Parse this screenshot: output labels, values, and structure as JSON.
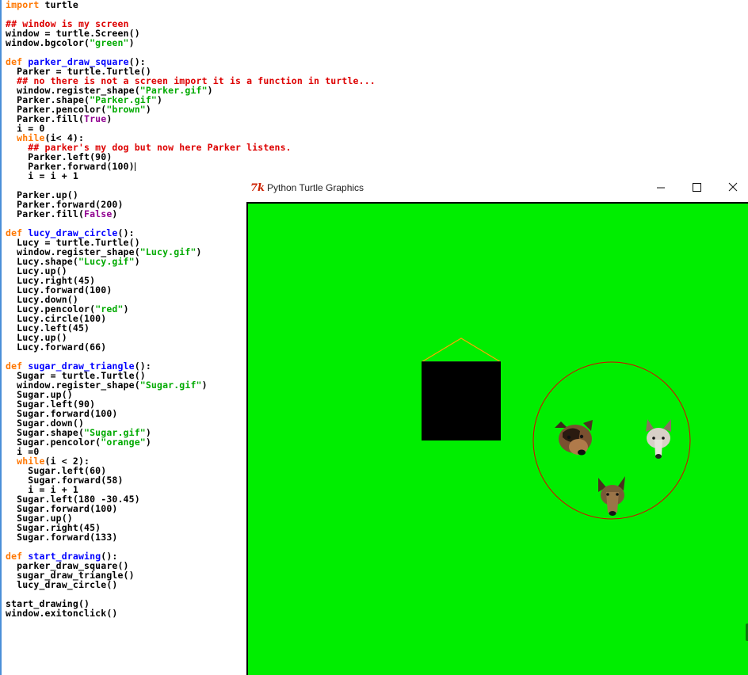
{
  "editor": {
    "lines": [
      {
        "parts": [
          {
            "t": "import",
            "c": "kw"
          },
          {
            "t": " turtle",
            "c": ""
          }
        ]
      },
      {
        "parts": []
      },
      {
        "parts": [
          {
            "t": "## window is my screen",
            "c": "cmt"
          }
        ]
      },
      {
        "parts": [
          {
            "t": "window = turtle.Screen()",
            "c": ""
          }
        ]
      },
      {
        "parts": [
          {
            "t": "window.bgcolor(",
            "c": ""
          },
          {
            "t": "\"green\"",
            "c": "str"
          },
          {
            "t": ")",
            "c": ""
          }
        ]
      },
      {
        "parts": []
      },
      {
        "parts": [
          {
            "t": "def",
            "c": "kw"
          },
          {
            "t": " ",
            "c": ""
          },
          {
            "t": "parker_draw_square",
            "c": "fn"
          },
          {
            "t": "():",
            "c": ""
          }
        ]
      },
      {
        "parts": [
          {
            "t": "  Parker = turtle.Turtle()",
            "c": ""
          }
        ]
      },
      {
        "parts": [
          {
            "t": "  ## no there is not a screen import it is a function in turtle...",
            "c": "cmt"
          }
        ]
      },
      {
        "parts": [
          {
            "t": "  window.register_shape(",
            "c": ""
          },
          {
            "t": "\"Parker.gif\"",
            "c": "str"
          },
          {
            "t": ")",
            "c": ""
          }
        ]
      },
      {
        "parts": [
          {
            "t": "  Parker.shape(",
            "c": ""
          },
          {
            "t": "\"Parker.gif\"",
            "c": "str"
          },
          {
            "t": ")",
            "c": ""
          }
        ]
      },
      {
        "parts": [
          {
            "t": "  Parker.pencolor(",
            "c": ""
          },
          {
            "t": "\"brown\"",
            "c": "str"
          },
          {
            "t": ")",
            "c": ""
          }
        ]
      },
      {
        "parts": [
          {
            "t": "  Parker.fill(",
            "c": ""
          },
          {
            "t": "True",
            "c": "bi"
          },
          {
            "t": ")",
            "c": ""
          }
        ]
      },
      {
        "parts": [
          {
            "t": "  i = 0",
            "c": ""
          }
        ]
      },
      {
        "parts": [
          {
            "t": "  ",
            "c": ""
          },
          {
            "t": "while",
            "c": "kw"
          },
          {
            "t": "(i< 4):",
            "c": ""
          }
        ]
      },
      {
        "parts": [
          {
            "t": "    ## parker's my dog but now here Parker listens.",
            "c": "cmt"
          }
        ]
      },
      {
        "parts": [
          {
            "t": "    Parker.left(90)",
            "c": ""
          }
        ]
      },
      {
        "parts": [
          {
            "t": "    Parker.forward(100)",
            "c": ""
          }
        ],
        "cursor": true
      },
      {
        "parts": [
          {
            "t": "    i = i + 1",
            "c": ""
          }
        ]
      },
      {
        "parts": []
      },
      {
        "parts": [
          {
            "t": "  Parker.up()",
            "c": ""
          }
        ]
      },
      {
        "parts": [
          {
            "t": "  Parker.forward(200)",
            "c": ""
          }
        ]
      },
      {
        "parts": [
          {
            "t": "  Parker.fill(",
            "c": ""
          },
          {
            "t": "False",
            "c": "bi"
          },
          {
            "t": ")",
            "c": ""
          }
        ]
      },
      {
        "parts": []
      },
      {
        "parts": [
          {
            "t": "def",
            "c": "kw"
          },
          {
            "t": " ",
            "c": ""
          },
          {
            "t": "lucy_draw_circle",
            "c": "fn"
          },
          {
            "t": "():",
            "c": ""
          }
        ]
      },
      {
        "parts": [
          {
            "t": "  Lucy = turtle.Turtle()",
            "c": ""
          }
        ]
      },
      {
        "parts": [
          {
            "t": "  window.register_shape(",
            "c": ""
          },
          {
            "t": "\"Lucy.gif\"",
            "c": "str"
          },
          {
            "t": ")",
            "c": ""
          }
        ]
      },
      {
        "parts": [
          {
            "t": "  Lucy.shape(",
            "c": ""
          },
          {
            "t": "\"Lucy.gif\"",
            "c": "str"
          },
          {
            "t": ")",
            "c": ""
          }
        ]
      },
      {
        "parts": [
          {
            "t": "  Lucy.up()",
            "c": ""
          }
        ]
      },
      {
        "parts": [
          {
            "t": "  Lucy.right(45)",
            "c": ""
          }
        ]
      },
      {
        "parts": [
          {
            "t": "  Lucy.forward(100)",
            "c": ""
          }
        ]
      },
      {
        "parts": [
          {
            "t": "  Lucy.down()",
            "c": ""
          }
        ]
      },
      {
        "parts": [
          {
            "t": "  Lucy.pencolor(",
            "c": ""
          },
          {
            "t": "\"red\"",
            "c": "str"
          },
          {
            "t": ")",
            "c": ""
          }
        ]
      },
      {
        "parts": [
          {
            "t": "  Lucy.circle(100)",
            "c": ""
          }
        ]
      },
      {
        "parts": [
          {
            "t": "  Lucy.left(45)",
            "c": ""
          }
        ]
      },
      {
        "parts": [
          {
            "t": "  Lucy.up()",
            "c": ""
          }
        ]
      },
      {
        "parts": [
          {
            "t": "  Lucy.forward(66)",
            "c": ""
          }
        ]
      },
      {
        "parts": []
      },
      {
        "parts": [
          {
            "t": "def",
            "c": "kw"
          },
          {
            "t": " ",
            "c": ""
          },
          {
            "t": "sugar_draw_triangle",
            "c": "fn"
          },
          {
            "t": "():",
            "c": ""
          }
        ]
      },
      {
        "parts": [
          {
            "t": "  Sugar = turtle.Turtle()",
            "c": ""
          }
        ]
      },
      {
        "parts": [
          {
            "t": "  window.register_shape(",
            "c": ""
          },
          {
            "t": "\"Sugar.gif\"",
            "c": "str"
          },
          {
            "t": ")",
            "c": ""
          }
        ]
      },
      {
        "parts": [
          {
            "t": "  Sugar.up()",
            "c": ""
          }
        ]
      },
      {
        "parts": [
          {
            "t": "  Sugar.left(90)",
            "c": ""
          }
        ]
      },
      {
        "parts": [
          {
            "t": "  Sugar.forward(100)",
            "c": ""
          }
        ]
      },
      {
        "parts": [
          {
            "t": "  Sugar.down()",
            "c": ""
          }
        ]
      },
      {
        "parts": [
          {
            "t": "  Sugar.shape(",
            "c": ""
          },
          {
            "t": "\"Sugar.gif\"",
            "c": "str"
          },
          {
            "t": ")",
            "c": ""
          }
        ]
      },
      {
        "parts": [
          {
            "t": "  Sugar.pencolor(",
            "c": ""
          },
          {
            "t": "\"orange\"",
            "c": "str"
          },
          {
            "t": ")",
            "c": ""
          }
        ]
      },
      {
        "parts": [
          {
            "t": "  i =0",
            "c": ""
          }
        ]
      },
      {
        "parts": [
          {
            "t": "  ",
            "c": ""
          },
          {
            "t": "while",
            "c": "kw"
          },
          {
            "t": "(i < 2):",
            "c": ""
          }
        ]
      },
      {
        "parts": [
          {
            "t": "    Sugar.left(60)",
            "c": ""
          }
        ]
      },
      {
        "parts": [
          {
            "t": "    Sugar.forward(58)",
            "c": ""
          }
        ]
      },
      {
        "parts": [
          {
            "t": "    i = i + 1",
            "c": ""
          }
        ]
      },
      {
        "parts": [
          {
            "t": "  Sugar.left(180 -30.45)",
            "c": ""
          }
        ]
      },
      {
        "parts": [
          {
            "t": "  Sugar.forward(100)",
            "c": ""
          }
        ]
      },
      {
        "parts": [
          {
            "t": "  Sugar.up()",
            "c": ""
          }
        ]
      },
      {
        "parts": [
          {
            "t": "  Sugar.right(45)",
            "c": ""
          }
        ]
      },
      {
        "parts": [
          {
            "t": "  Sugar.forward(133)",
            "c": ""
          }
        ]
      },
      {
        "parts": []
      },
      {
        "parts": [
          {
            "t": "def",
            "c": "kw"
          },
          {
            "t": " ",
            "c": ""
          },
          {
            "t": "start_drawing",
            "c": "fn"
          },
          {
            "t": "():",
            "c": ""
          }
        ]
      },
      {
        "parts": [
          {
            "t": "  parker_draw_square()",
            "c": ""
          }
        ]
      },
      {
        "parts": [
          {
            "t": "  sugar_draw_triangle()",
            "c": ""
          }
        ]
      },
      {
        "parts": [
          {
            "t": "  lucy_draw_circle()",
            "c": ""
          }
        ]
      },
      {
        "parts": []
      },
      {
        "parts": [
          {
            "t": "start_drawing()",
            "c": ""
          }
        ]
      },
      {
        "parts": [
          {
            "t": "window.exitonclick()",
            "c": ""
          }
        ]
      }
    ]
  },
  "turtle_window": {
    "icon_text": "7k",
    "title": "Python Turtle Graphics",
    "canvas_color": "#00ee00",
    "square_fill": "#000000",
    "triangle_color": "#ffa500",
    "circle_color": "#dd0000"
  },
  "icons": {
    "minimize": "minimize-icon",
    "maximize": "maximize-icon",
    "close": "close-icon"
  }
}
